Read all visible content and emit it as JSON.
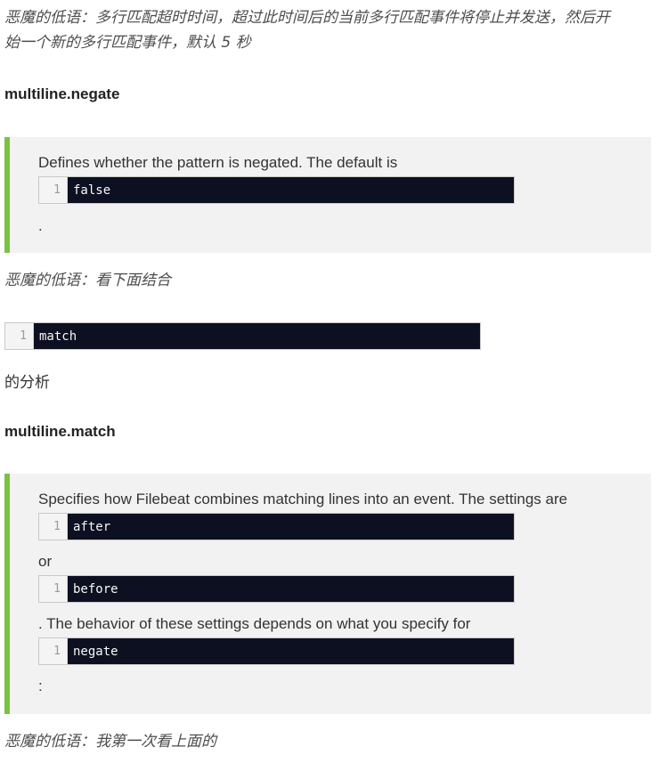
{
  "notes": {
    "timeout_line1": "恶魔的低语：多行匹配超时时间，超过此时间后的当前多行匹配事件将停止并发送，然后开",
    "timeout_line2": "始一个新的多行匹配事件，默认 5 秒",
    "combine_with": "恶魔的低语：看下面结合",
    "first_look": "恶魔的低语：我第一次看上面的"
  },
  "negate_section": {
    "heading": "multiline.negate",
    "quote_text": "Defines whether the pattern is negated. The default is",
    "code_line_no": "1",
    "code_value": "false",
    "trailing": "."
  },
  "match_inline": {
    "code_line_no": "1",
    "code_value": "match",
    "after_text": "的分析"
  },
  "match_section": {
    "heading": "multiline.match",
    "quote_text_1": "Specifies how Filebeat combines matching lines into an event. The settings are",
    "code1_line_no": "1",
    "code1_value": "after",
    "or_text": "or",
    "code2_line_no": "1",
    "code2_value": "before",
    "quote_text_2": ". The behavior of these settings depends on what you specify for",
    "code3_line_no": "1",
    "code3_value": "negate",
    "trailing": ":"
  }
}
